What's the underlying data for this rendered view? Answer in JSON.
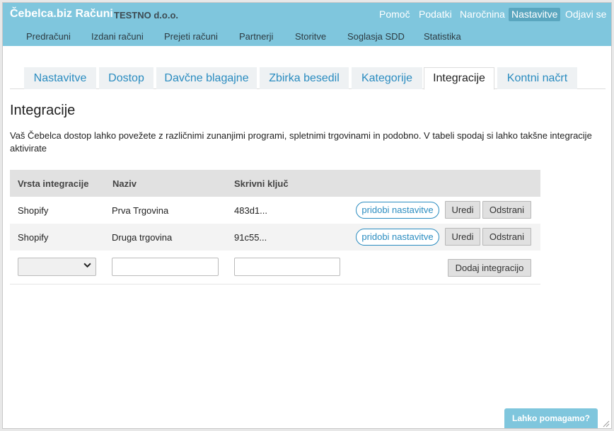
{
  "header": {
    "brand": "Čebelca.biz Računi",
    "company": "TESTNO d.o.o.",
    "top_nav": [
      "Pomoč",
      "Podatki",
      "Naročnina",
      "Nastavitve",
      "Odjavi se"
    ],
    "main_nav": [
      "Predračuni",
      "Izdani računi",
      "Prejeti računi",
      "Partnerji",
      "Storitve",
      "Soglasja SDD",
      "Statistika"
    ]
  },
  "tabs": [
    "Nastavitve",
    "Dostop",
    "Davčne blagajne",
    "Zbirka besedil",
    "Kategorije",
    "Integracije",
    "Kontni načrt"
  ],
  "page": {
    "title": "Integracije",
    "description": "Vaš Čebelca dostop lahko povežete z različnimi zunanjimi programi, spletnimi trgovinami in podobno. V tabeli spodaj si lahko takšne integracije aktivirate"
  },
  "table": {
    "columns": [
      "Vrsta integracije",
      "Naziv",
      "Skrivni ključ"
    ],
    "rows": [
      {
        "type": "Shopify",
        "name": "Prva Trgovina",
        "key": "483d1..."
      },
      {
        "type": "Shopify",
        "name": "Druga trgovina",
        "key": "91c55..."
      }
    ],
    "settings_label": "pridobi nastavitve",
    "edit_label": "Uredi",
    "delete_label": "Odstrani",
    "add_label": "Dodaj integracijo"
  },
  "help_label": "Lahko pomagamo?",
  "colors": {
    "header_bg": "#7fc6dd",
    "active_nav": "#5aa6bf",
    "link": "#2a8cc0"
  }
}
